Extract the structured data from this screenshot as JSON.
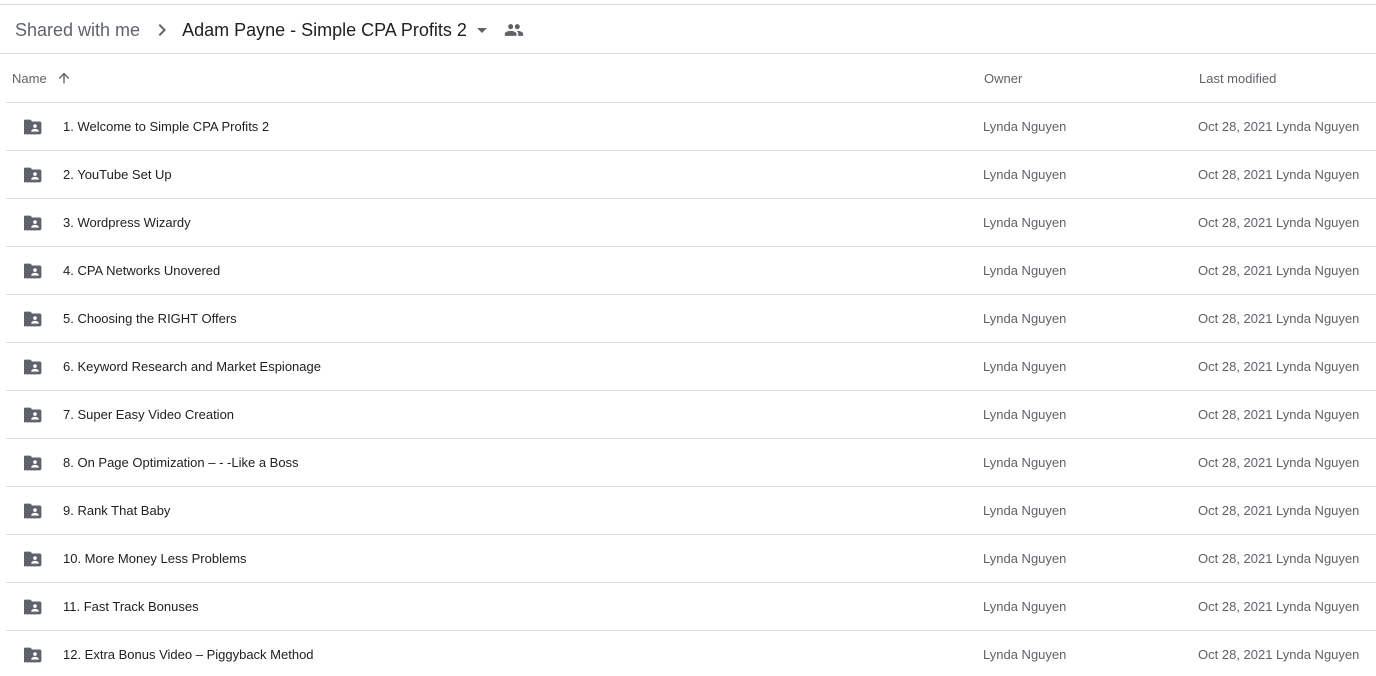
{
  "breadcrumb": {
    "root": "Shared with me",
    "separator_icon": "chevron-right-icon",
    "current": "Adam Payne - Simple CPA Profits 2",
    "dropdown_icon": "arrow-drop-down-icon",
    "shared_icon": "people-icon"
  },
  "columns": {
    "name": "Name",
    "sort_icon": "arrow-upward-icon",
    "owner": "Owner",
    "last_modified": "Last modified"
  },
  "rows": [
    {
      "name": "1. Welcome to Simple CPA Profits 2",
      "owner": "Lynda Nguyen",
      "date": "Oct 28, 2021",
      "modified_by": "Lynda Nguyen",
      "icon": "shared-folder-icon"
    },
    {
      "name": "2. YouTube Set Up",
      "owner": "Lynda Nguyen",
      "date": "Oct 28, 2021",
      "modified_by": "Lynda Nguyen",
      "icon": "shared-folder-icon"
    },
    {
      "name": "3. Wordpress Wizardy",
      "owner": "Lynda Nguyen",
      "date": "Oct 28, 2021",
      "modified_by": "Lynda Nguyen",
      "icon": "shared-folder-icon"
    },
    {
      "name": "4. CPA Networks Unovered",
      "owner": "Lynda Nguyen",
      "date": "Oct 28, 2021",
      "modified_by": "Lynda Nguyen",
      "icon": "shared-folder-icon"
    },
    {
      "name": "5. Choosing the RIGHT Offers",
      "owner": "Lynda Nguyen",
      "date": "Oct 28, 2021",
      "modified_by": "Lynda Nguyen",
      "icon": "shared-folder-icon"
    },
    {
      "name": "6. Keyword Research and Market Espionage",
      "owner": "Lynda Nguyen",
      "date": "Oct 28, 2021",
      "modified_by": "Lynda Nguyen",
      "icon": "shared-folder-icon"
    },
    {
      "name": "7. Super Easy Video Creation",
      "owner": "Lynda Nguyen",
      "date": "Oct 28, 2021",
      "modified_by": "Lynda Nguyen",
      "icon": "shared-folder-icon"
    },
    {
      "name": "8. On Page Optimization – - -Like a Boss",
      "owner": "Lynda Nguyen",
      "date": "Oct 28, 2021",
      "modified_by": "Lynda Nguyen",
      "icon": "shared-folder-icon"
    },
    {
      "name": "9. Rank That Baby",
      "owner": "Lynda Nguyen",
      "date": "Oct 28, 2021",
      "modified_by": "Lynda Nguyen",
      "icon": "shared-folder-icon"
    },
    {
      "name": "10. More Money Less Problems",
      "owner": "Lynda Nguyen",
      "date": "Oct 28, 2021",
      "modified_by": "Lynda Nguyen",
      "icon": "shared-folder-icon"
    },
    {
      "name": "11. Fast Track Bonuses",
      "owner": "Lynda Nguyen",
      "date": "Oct 28, 2021",
      "modified_by": "Lynda Nguyen",
      "icon": "shared-folder-icon"
    },
    {
      "name": "12. Extra Bonus Video – Piggyback Method",
      "owner": "Lynda Nguyen",
      "date": "Oct 28, 2021",
      "modified_by": "Lynda Nguyen",
      "icon": "shared-folder-icon"
    }
  ],
  "colors": {
    "primary_text": "#202124",
    "secondary_text": "#5f6368",
    "divider": "#dadce0",
    "icon": "#5f6368"
  }
}
